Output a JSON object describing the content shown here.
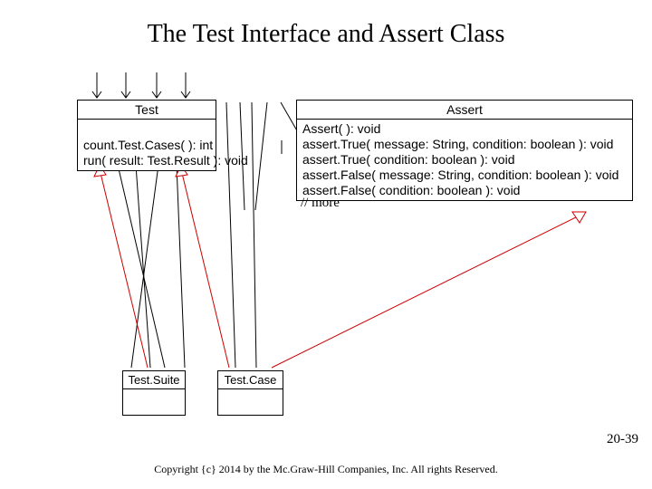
{
  "slide": {
    "title": "The Test Interface and Assert Class",
    "page_number": "20-39",
    "copyright": "Copyright {c} 2014 by the Mc.Graw-Hill Companies, Inc. All rights Reserved."
  },
  "more_comment": "// more",
  "boxes": {
    "test": {
      "name": "Test",
      "ops": [
        "count.Test.Cases( ): int",
        "run( result: Test.Result ): void"
      ]
    },
    "assert": {
      "name": "Assert",
      "ops": [
        "Assert( ): void",
        "assert.True( message: String, condition: boolean ): void",
        "assert.True( condition: boolean ): void",
        "assert.False( message: String, condition: boolean ): void",
        "assert.False( condition: boolean ): void"
      ]
    },
    "suite": {
      "name": "Test.Suite"
    },
    "case": {
      "name": "Test.Case"
    }
  }
}
